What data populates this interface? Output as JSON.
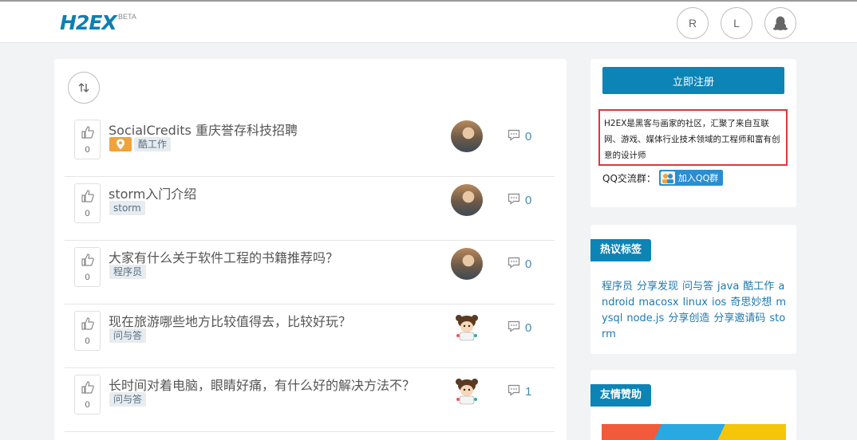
{
  "header": {
    "logo": "H2EX",
    "logo_badge": "BETA",
    "buttons": [
      "R",
      "L"
    ],
    "qq_icon": "penguin-icon"
  },
  "colors": {
    "brand": "#0c84b6",
    "tag_location": "#f0a33a",
    "highlight_border": "#e0363b"
  },
  "feed": {
    "sort_icon": "sort-arrows-icon",
    "posts": [
      {
        "title": "SocialCredits 重庆誉存科技招聘",
        "votes": "0",
        "comments": "0",
        "tags": [
          "酷工作"
        ],
        "location": true,
        "avatar": "photo"
      },
      {
        "title": "storm入门介绍",
        "votes": "0",
        "comments": "0",
        "tags": [
          "storm"
        ],
        "location": false,
        "avatar": "photo"
      },
      {
        "title": "大家有什么关于软件工程的书籍推荐吗？",
        "votes": "0",
        "comments": "0",
        "tags": [
          "程序员"
        ],
        "location": false,
        "avatar": "photo"
      },
      {
        "title": "现在旅游哪些地方比较值得去，比较好玩？",
        "votes": "0",
        "comments": "0",
        "tags": [
          "问与答"
        ],
        "location": false,
        "avatar": "cartoon"
      },
      {
        "title": "长时间对着电脑，眼睛好痛，有什么好的解决方法不？",
        "votes": "0",
        "comments": "1",
        "tags": [
          "问与答"
        ],
        "location": false,
        "avatar": "cartoon"
      }
    ]
  },
  "sidebar": {
    "register_label": "立即注册",
    "intro": "H2EX是黑客与画家的社区，汇聚了来自互联网、游戏、媒体行业技术领域的工程师和富有创意的设计师",
    "qq_group_label": "QQ交流群：",
    "qq_join_label": "加入QQ群",
    "hot_tags_title": "热议标签",
    "hot_tags": [
      "程序员",
      "分享发现",
      "问与答",
      "java",
      "酷工作",
      "android",
      "macosx",
      "linux",
      "ios",
      "奇思妙想",
      "mysql",
      "node.js",
      "分享创造",
      "分享邀请码",
      "storm"
    ],
    "sponsor_title": "友情赞助"
  }
}
